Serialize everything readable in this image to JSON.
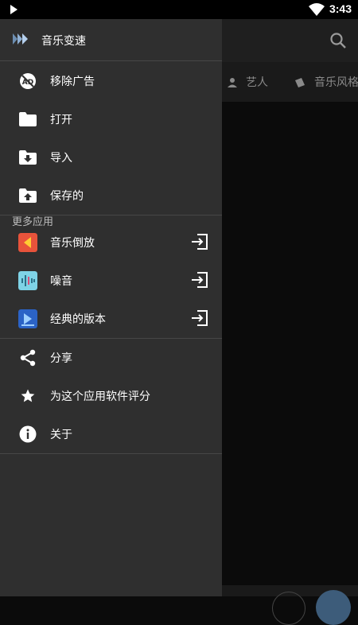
{
  "status": {
    "time": "3:43"
  },
  "background": {
    "tabs": [
      {
        "label": "艺人"
      },
      {
        "label": "音乐风格"
      }
    ]
  },
  "drawer": {
    "title": "音乐变速",
    "main_items": [
      {
        "label": "移除广告",
        "icon": "remove-ads-icon"
      },
      {
        "label": "打开",
        "icon": "folder-icon"
      },
      {
        "label": "导入",
        "icon": "import-icon"
      },
      {
        "label": "保存的",
        "icon": "saved-icon"
      }
    ],
    "section_title": "更多应用",
    "more_apps": [
      {
        "label": "音乐倒放",
        "icon": "reverse-music-app-icon",
        "color": "#e8533b"
      },
      {
        "label": "噪音",
        "icon": "noise-app-icon",
        "color": "#7fd3e6"
      },
      {
        "label": "经典的版本",
        "icon": "classic-version-app-icon",
        "color": "#2b63c6"
      }
    ],
    "bottom_items": [
      {
        "label": "分享",
        "icon": "share-icon"
      },
      {
        "label": "为这个应用软件评分",
        "icon": "star-icon"
      },
      {
        "label": "关于",
        "icon": "info-icon"
      }
    ]
  }
}
